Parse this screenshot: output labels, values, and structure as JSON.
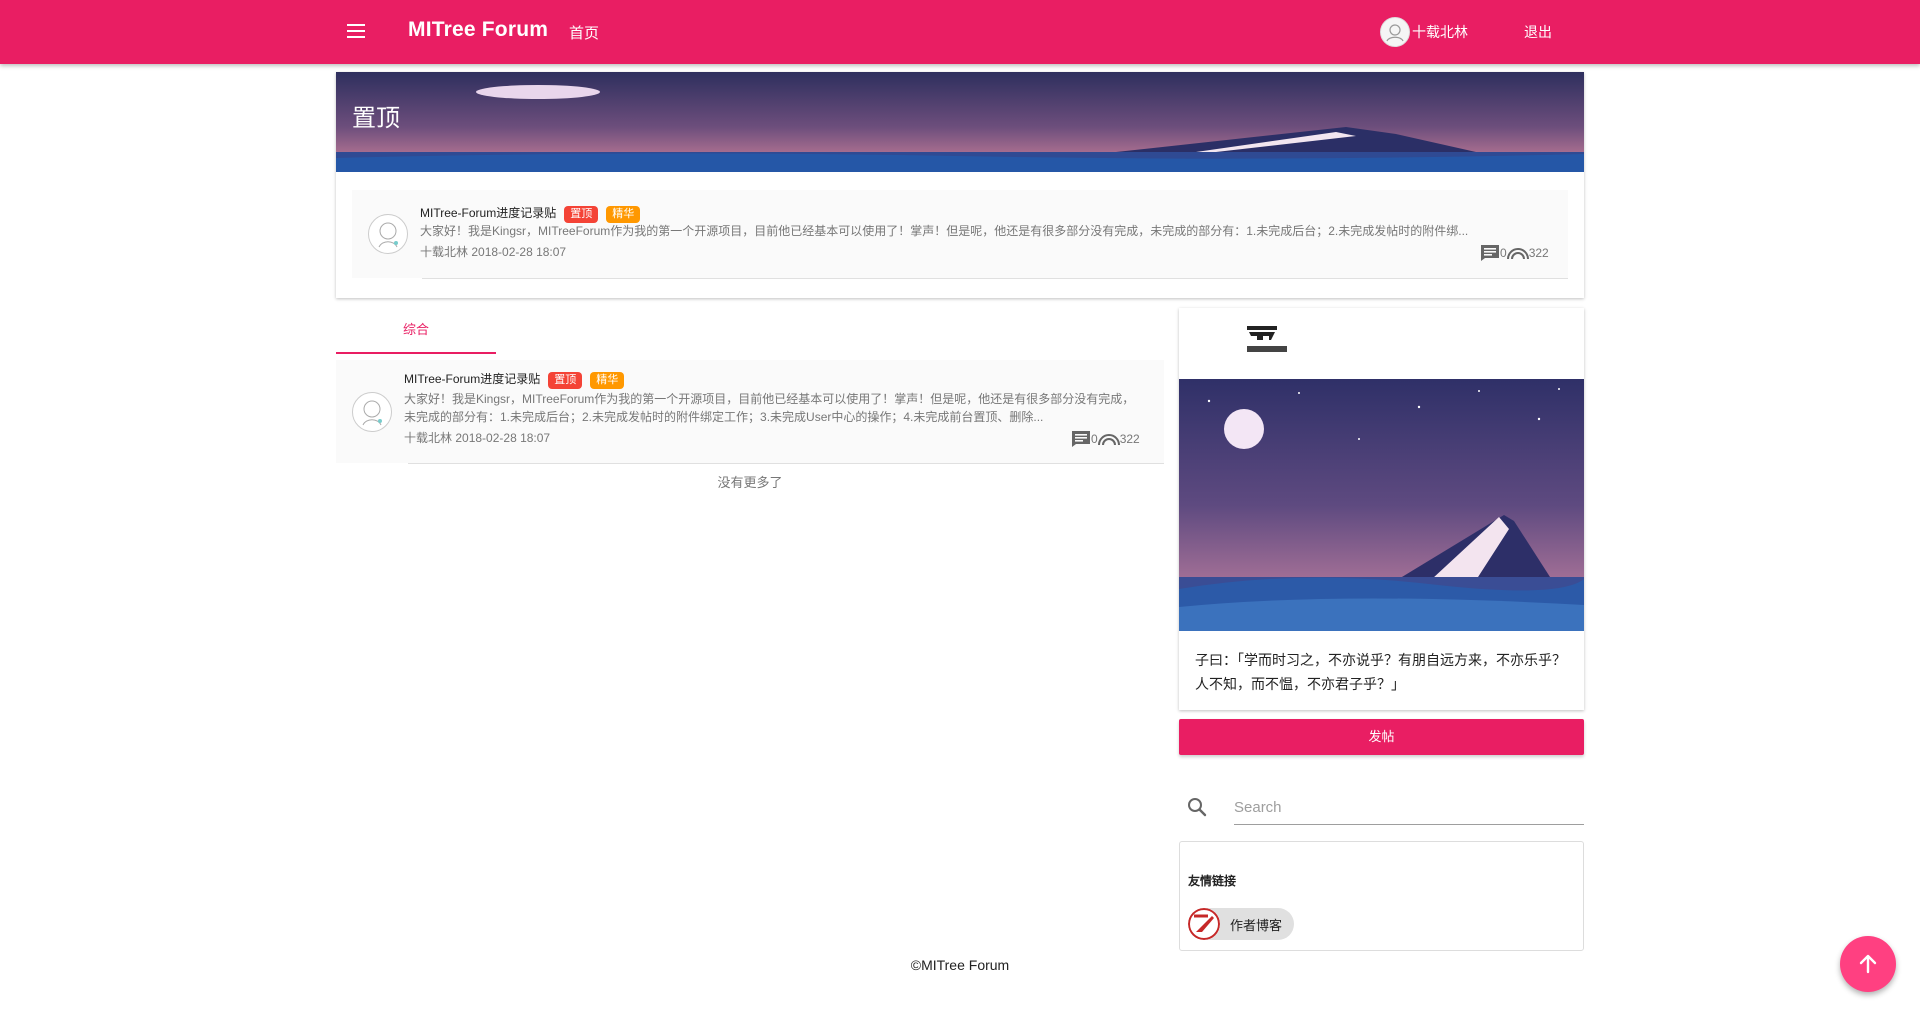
{
  "header": {
    "brand": "MITree Forum",
    "nav_home": "首页",
    "user_name": "十载北林",
    "logout": "退出",
    "color": "#e91e63"
  },
  "pinned": {
    "title": "置顶",
    "post": {
      "title": "MITree-Forum进度记录贴",
      "tags": [
        "置顶",
        "精华"
      ],
      "excerpt": "大家好！我是Kingsr，MITreeForum作为我的第一个开源项目，目前他已经基本可以使用了！掌声！但是呢，他还是有很多部分没有完成，未完成的部分有：1.未完成后台；2.未完成发帖时的附件绑...",
      "author": "十载北林",
      "date": "2018-02-28 18:07",
      "comments": "0",
      "views": "322"
    }
  },
  "tabs": {
    "active": "综合"
  },
  "list": {
    "post": {
      "title": "MITree-Forum进度记录贴",
      "tags": [
        "置顶",
        "精华"
      ],
      "excerpt": "大家好！我是Kingsr，MITreeForum作为我的第一个开源项目，目前他已经基本可以使用了！掌声！但是呢，他还是有很多部分没有完成，未完成的部分有：1.未完成后台；2.未完成发帖时的附件绑定工作；3.未完成User中心的操作；4.未完成前台置顶、删除...",
      "author": "十载北林",
      "date": "2018-02-28 18:07",
      "comments": "0",
      "views": "322"
    },
    "no_more": "没有更多了"
  },
  "sidebar": {
    "quote": "子曰：「学而时习之，不亦说乎？有朋自远方来，不亦乐乎？人不知，而不愠，不亦君子乎？」",
    "post_button": "发帖",
    "search_placeholder": "Search",
    "links_title": "友情链接",
    "links": [
      {
        "label": "作者博客"
      }
    ]
  },
  "footer": "©MITree Forum",
  "icons": {
    "menu": "menu-icon",
    "comment": "comment-icon",
    "views": "rainbow-icon",
    "search": "search-icon",
    "scroll_top": "arrow-up-icon"
  }
}
